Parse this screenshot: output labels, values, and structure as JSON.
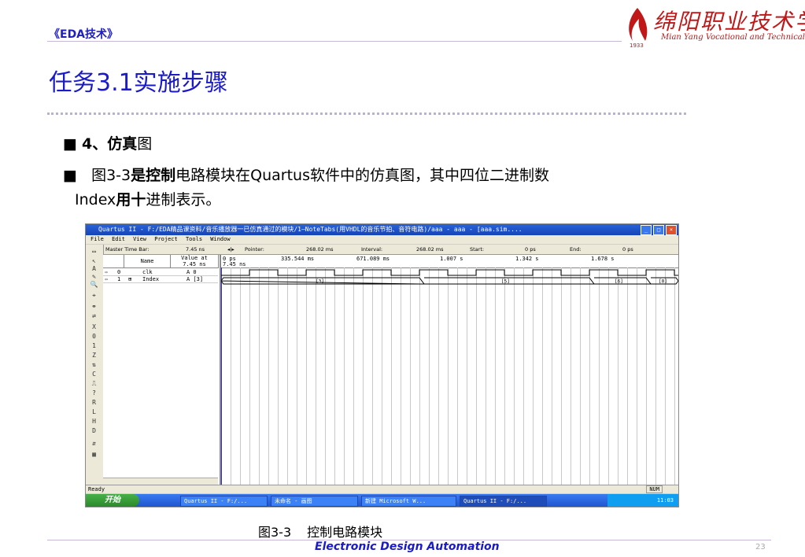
{
  "header": {
    "course": "《EDA技术》"
  },
  "logo": {
    "text": "绵阳职业技术学院",
    "subtitle": "Mian Yang Vocational and Technical College",
    "year": "1933"
  },
  "slide": {
    "title": "任务3.1实施步骤",
    "bullet1_num": "4、",
    "bullet1_bold": "仿真",
    "bullet1_rest": "图",
    "bullet2_a": "图3-3",
    "bullet2_b": "是控制",
    "bullet2_c": "电路模块在Quartus软件中的仿真图，其中四位二进制数",
    "bullet3_a": "Index",
    "bullet3_b": "用十",
    "bullet3_c": "进制表示。"
  },
  "screenshot": {
    "window_title": "Quartus II - F:/EDA精品课资料/音乐播放器一已仿真通过的模块/1—NoteTabs(用VHDL的音乐节拍、音符电路)/aaa - aaa - [aaa.sim....",
    "menu": [
      "File",
      "Edit",
      "View",
      "Project",
      "Tools",
      "Window"
    ],
    "toolbar": {
      "master_label": "Master Time Bar:",
      "master_value": "7.45 ns",
      "pointer_label": "Pointer:",
      "pointer_value": "268.02 ms",
      "interval_label": "Interval:",
      "interval_value": "268.02 ms",
      "start_label": "Start:",
      "start_value": "0 ps",
      "end_label": "End:",
      "end_value": "0 ps"
    },
    "columns": {
      "name": "Name",
      "value": "Value at\n7.45 ns"
    },
    "timeline": [
      "0 ps",
      "335.544 ms",
      "671.089 ms",
      "1.007 s",
      "1.342 s",
      "1.678 s"
    ],
    "cursor_label": "7.45 ns",
    "signals": [
      {
        "num": "0",
        "name": "clk",
        "value": "A 0"
      },
      {
        "num": "1",
        "name": "Index",
        "value": "A [3]"
      }
    ],
    "bus_values": [
      "[3]",
      "[5]",
      "[6]",
      "[0]"
    ],
    "status": "Ready",
    "status_right": "NUM",
    "taskbar": {
      "start": "开始",
      "tasks": [
        "Quartus II - F:/...",
        "未命名 - 画图",
        "新建 Microsoft W...",
        "Quartus II - F:/..."
      ],
      "clock": "11:03"
    }
  },
  "caption": {
    "fig": "图3-3",
    "text": "控制电路模块"
  },
  "footer": {
    "text": "Electronic Design Automation",
    "page": "23"
  },
  "colors": {
    "accent": "#1a1ac8",
    "logo_red": "#c01818",
    "divider": "#c7b8d8"
  }
}
